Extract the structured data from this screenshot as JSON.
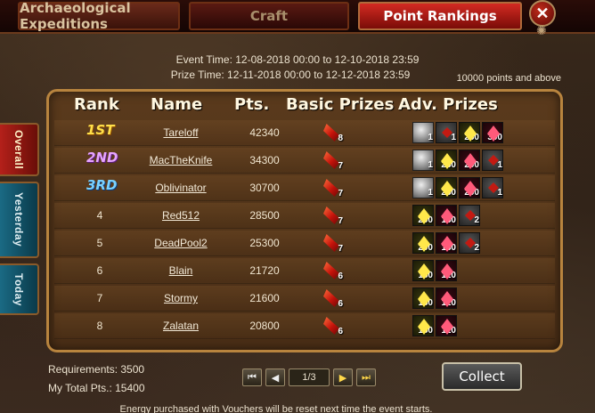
{
  "tabs": {
    "archaeological": "Archaeological Expeditions",
    "craft": "Craft",
    "point_rankings": "Point Rankings"
  },
  "close_label": "✕",
  "event": {
    "event_time": "Event Time: 12-08-2018 00:00 to 12-10-2018 23:59",
    "prize_time": "Prize Time: 12-11-2018 00:00 to 12-12-2018 23:59",
    "points_note": "10000 points and above"
  },
  "side_tabs": {
    "overall": "Overall",
    "yesterday": "Yesterday",
    "today": "Today"
  },
  "table": {
    "headers": {
      "rank": "Rank",
      "name": "Name",
      "pts": "Pts.",
      "basic": "Basic Prizes",
      "adv": "Adv. Prizes"
    },
    "rows": [
      {
        "rank": "1ST",
        "badge": "rb1",
        "name": "Tareloff",
        "pts": "42340",
        "basic_count": "8",
        "adv": [
          {
            "type": "gem-silver",
            "count": "1"
          },
          {
            "type": "gem-red",
            "count": "1"
          },
          {
            "type": "gem-yellow",
            "count": "250"
          },
          {
            "type": "gem-pink",
            "count": "300"
          }
        ]
      },
      {
        "rank": "2ND",
        "badge": "rb2",
        "name": "MacTheKnife",
        "pts": "34300",
        "basic_count": "7",
        "adv": [
          {
            "type": "gem-silver",
            "count": "1"
          },
          {
            "type": "gem-yellow",
            "count": "250"
          },
          {
            "type": "gem-pink",
            "count": "200"
          },
          {
            "type": "gem-red",
            "count": "1"
          }
        ]
      },
      {
        "rank": "3RD",
        "badge": "rb3",
        "name": "Oblivinator",
        "pts": "30700",
        "basic_count": "7",
        "adv": [
          {
            "type": "gem-silver",
            "count": "1"
          },
          {
            "type": "gem-yellow",
            "count": "250"
          },
          {
            "type": "gem-pink",
            "count": "200"
          },
          {
            "type": "gem-red",
            "count": "1"
          }
        ]
      },
      {
        "rank": "4",
        "badge": "",
        "name": "Red512",
        "pts": "28500",
        "basic_count": "7",
        "adv": [
          {
            "type": "gem-yellow",
            "count": "200"
          },
          {
            "type": "gem-pink",
            "count": "150"
          },
          {
            "type": "gem-red",
            "count": "2"
          }
        ]
      },
      {
        "rank": "5",
        "badge": "",
        "name": "DeadPool2",
        "pts": "25300",
        "basic_count": "7",
        "adv": [
          {
            "type": "gem-yellow",
            "count": "200"
          },
          {
            "type": "gem-pink",
            "count": "150"
          },
          {
            "type": "gem-red",
            "count": "2"
          }
        ]
      },
      {
        "rank": "6",
        "badge": "",
        "name": "Blain",
        "pts": "21720",
        "basic_count": "6",
        "adv": [
          {
            "type": "gem-yellow",
            "count": "180"
          },
          {
            "type": "gem-pink",
            "count": "120"
          }
        ]
      },
      {
        "rank": "7",
        "badge": "",
        "name": "Stormy",
        "pts": "21600",
        "basic_count": "6",
        "adv": [
          {
            "type": "gem-yellow",
            "count": "180"
          },
          {
            "type": "gem-pink",
            "count": "120"
          }
        ]
      },
      {
        "rank": "8",
        "badge": "",
        "name": "Zalatan",
        "pts": "20800",
        "basic_count": "6",
        "adv": [
          {
            "type": "gem-yellow",
            "count": "180"
          },
          {
            "type": "gem-pink",
            "count": "120"
          }
        ]
      }
    ]
  },
  "requirements": "Requirements: 3500",
  "my_total": "My Total Pts.: 15400",
  "pager": {
    "page": "1/3"
  },
  "collect_label": "Collect",
  "footer_note": "Energy purchased with Vouchers will be reset next time the event starts."
}
